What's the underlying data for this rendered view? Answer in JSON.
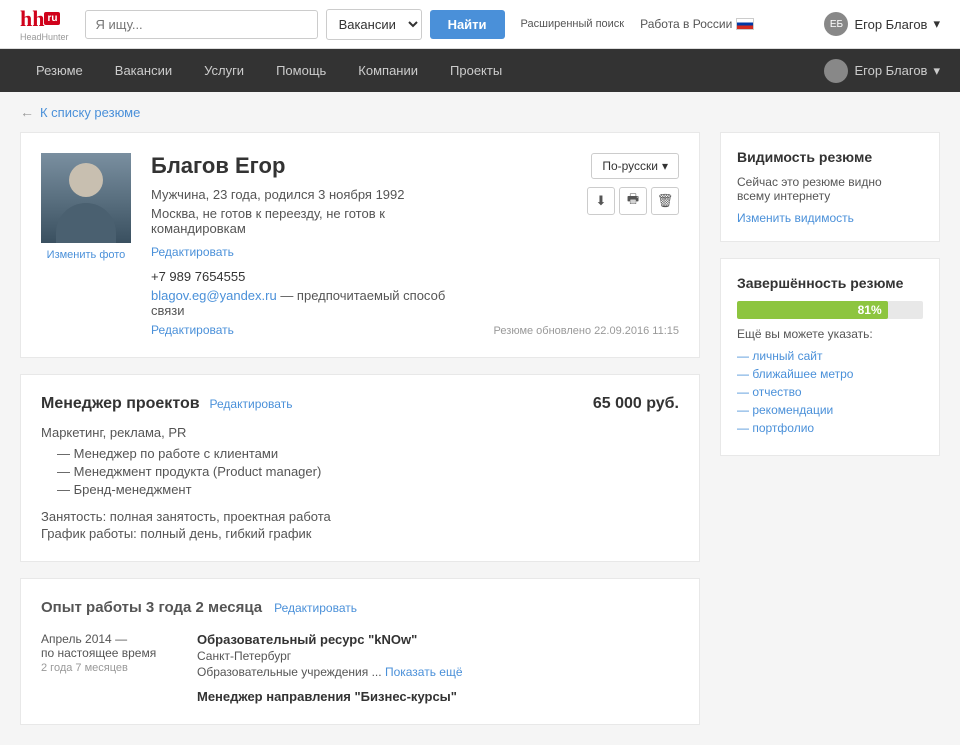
{
  "header": {
    "logo_hh": "hh",
    "logo_ru": "ru",
    "logo_subtitle": "HeadHunter",
    "search_placeholder": "Я ищу...",
    "vacancy_label": "Вакансии",
    "search_btn": "Найти",
    "advanced_search": "Расширенный\nпоиск",
    "russia_label": "Работа в России",
    "user_name": "Егор Благов",
    "user_initials": "ЕБ"
  },
  "nav": {
    "items": [
      {
        "label": "Резюме",
        "id": "resume"
      },
      {
        "label": "Вакансии",
        "id": "vacancies"
      },
      {
        "label": "Услуги",
        "id": "services"
      },
      {
        "label": "Помощь",
        "id": "help"
      },
      {
        "label": "Компании",
        "id": "companies"
      },
      {
        "label": "Проекты",
        "id": "projects"
      }
    ],
    "user_name": "Егор Благов"
  },
  "breadcrumb": {
    "back_label": "К списку резюме"
  },
  "profile": {
    "name": "Благов Егор",
    "details": "Мужчина, 23 года, родился 3 ноября 1992",
    "location": "Москва, не готов к переезду, не готов к командировкам",
    "edit_label": "Редактировать",
    "change_photo": "Изменить фото",
    "phone": "+7 989 7654555",
    "email": "blagov.eg@yandex.ru",
    "email_note": " — предпочитаемый способ связи",
    "edit_contact_label": "Редактировать",
    "lang_label": "По-русски",
    "updated": "Резюме обновлено 22.09.2016 11:15"
  },
  "job": {
    "title": "Менеджер проектов",
    "edit_label": "Редактировать",
    "salary": "65 000 руб.",
    "category": "Маркетинг, реклама, PR",
    "list_items": [
      "— Менеджер по работе с клиентами",
      "— Менеджмент продукта (Product manager)",
      "— Бренд-менеджмент"
    ],
    "employment": "Занятость: полная занятость, проектная работа",
    "schedule": "График работы: полный день, гибкий график"
  },
  "experience": {
    "title": "Опыт работы 3 года 2 месяца",
    "edit_label": "Редактировать",
    "items": [
      {
        "date_range": "Апрель 2014 —\nпо настоящее время",
        "duration": "2 года 7 месяцев",
        "company": "Образовательный ресурс \"kNOw\"",
        "city": "Санкт-Петербург",
        "industry": "Образовательные учреждения ...",
        "show_more": "Показать ещё",
        "position": "Менеджер направления \"Бизнес-курсы\""
      }
    ]
  },
  "sidebar": {
    "visibility_title": "Видимость резюме",
    "visibility_text": "Сейчас это резюме видно\nвсему интернету",
    "visibility_link": "Изменить видимость",
    "completion_title": "Завершённость резюме",
    "progress_value": 81,
    "progress_label": "81%",
    "suggest_label": "Ещё вы можете указать:",
    "suggest_items": [
      "— личный сайт",
      "— ближайшее метро",
      "— отчество",
      "— рекомендации",
      "— портфолио"
    ]
  },
  "icons": {
    "back_arrow": "←",
    "download": "⬇",
    "print": "🖨",
    "delete": "🗑",
    "chevron_down": "▾"
  }
}
